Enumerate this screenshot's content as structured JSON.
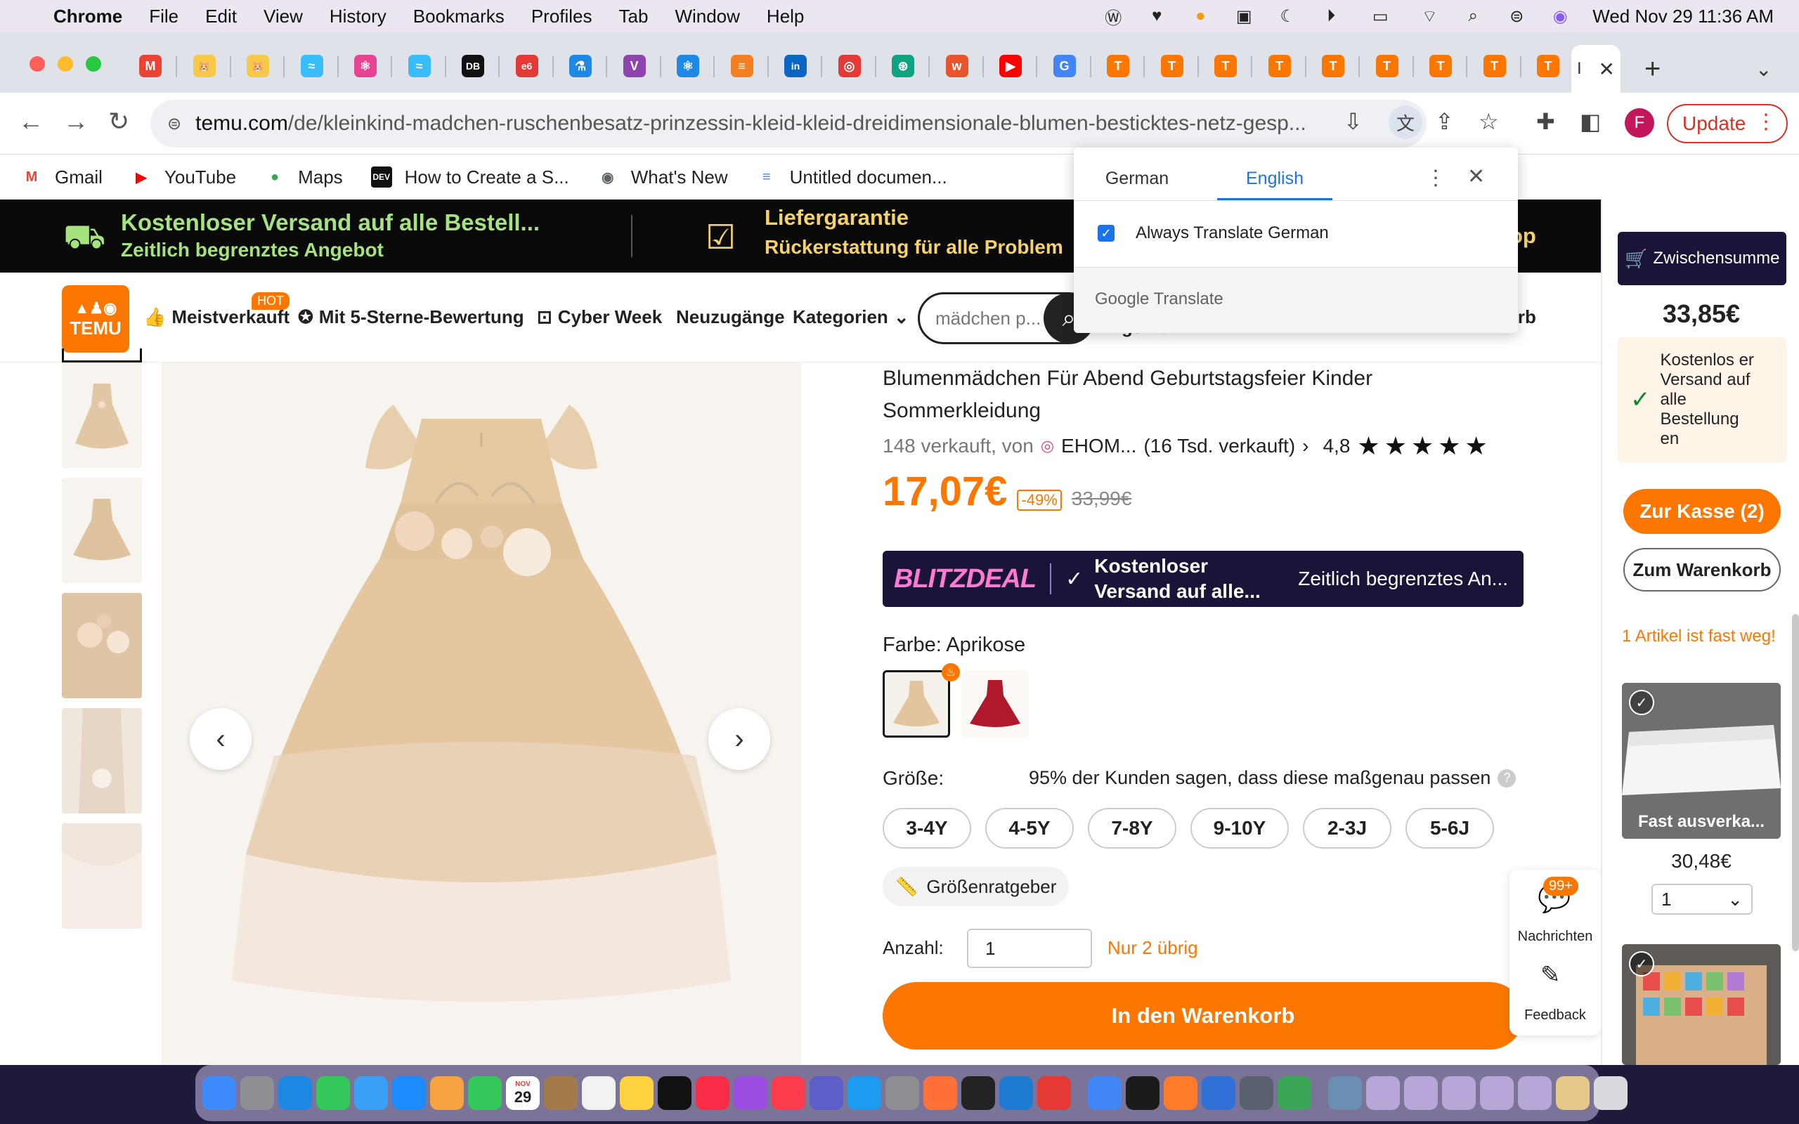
{
  "menubar": {
    "app": "Chrome",
    "items": [
      "File",
      "Edit",
      "View",
      "History",
      "Bookmarks",
      "Profiles",
      "Tab",
      "Window",
      "Help"
    ],
    "datetime": "Wed Nov 29  11:36 AM"
  },
  "tabs": {
    "active_label": "I",
    "favicons": [
      {
        "icon": "gmail-icon",
        "glyph": "M",
        "color": "#ea4335"
      },
      {
        "icon": "hamster-icon",
        "glyph": "🐹",
        "color": "#f7c948"
      },
      {
        "icon": "hamster-icon",
        "glyph": "🐹",
        "color": "#f7c948"
      },
      {
        "icon": "tailwind-icon",
        "glyph": "≈",
        "color": "#38bdf8"
      },
      {
        "icon": "react-icon",
        "glyph": "⚛",
        "color": "#e84393"
      },
      {
        "icon": "tailwind-icon",
        "glyph": "≈",
        "color": "#38bdf8"
      },
      {
        "icon": "db-icon",
        "glyph": "DB",
        "color": "#111111"
      },
      {
        "icon": "e6-icon",
        "glyph": "e6",
        "color": "#e53935"
      },
      {
        "icon": "flask-icon",
        "glyph": "⚗",
        "color": "#1e88e5"
      },
      {
        "icon": "vite-icon",
        "glyph": "V",
        "color": "#8e44ad"
      },
      {
        "icon": "react-icon",
        "glyph": "⚛",
        "color": "#1e88e5"
      },
      {
        "icon": "stackoverflow-icon",
        "glyph": "≡",
        "color": "#f48024"
      },
      {
        "icon": "linkedin-icon",
        "glyph": "in",
        "color": "#0a66c2"
      },
      {
        "icon": "app-icon",
        "glyph": "◎",
        "color": "#e53935"
      },
      {
        "icon": "chatgpt-icon",
        "glyph": "⊛",
        "color": "#10a37f"
      },
      {
        "icon": "w-icon",
        "glyph": "w",
        "color": "#e8552d"
      },
      {
        "icon": "youtube-icon",
        "glyph": "▶",
        "color": "#ff0000"
      },
      {
        "icon": "google-icon",
        "glyph": "G",
        "color": "#4285f4"
      },
      {
        "icon": "temu-icon",
        "glyph": "T",
        "color": "#fb7701"
      },
      {
        "icon": "temu-icon",
        "glyph": "T",
        "color": "#fb7701"
      },
      {
        "icon": "temu-icon",
        "glyph": "T",
        "color": "#fb7701"
      },
      {
        "icon": "temu-icon",
        "glyph": "T",
        "color": "#fb7701"
      },
      {
        "icon": "temu-icon",
        "glyph": "T",
        "color": "#fb7701"
      },
      {
        "icon": "temu-icon",
        "glyph": "T",
        "color": "#fb7701"
      },
      {
        "icon": "temu-icon",
        "glyph": "T",
        "color": "#fb7701"
      },
      {
        "icon": "temu-icon",
        "glyph": "T",
        "color": "#fb7701"
      },
      {
        "icon": "temu-icon",
        "glyph": "T",
        "color": "#fb7701"
      }
    ]
  },
  "address": {
    "host": "temu.com",
    "path": "/de/kleinkind-madchen-ruschenbesatz-prinzessin-kleid-kleid-dreidimensionale-blumen-besticktes-netz-gesp..."
  },
  "toolbar": {
    "update_label": "Update",
    "profile_initial": "F"
  },
  "bookmarks": [
    {
      "label": "Gmail",
      "icon": "gmail-icon",
      "glyph": "M",
      "color": "#ea4335"
    },
    {
      "label": "YouTube",
      "icon": "youtube-icon",
      "glyph": "▶",
      "color": "#ff0000"
    },
    {
      "label": "Maps",
      "icon": "maps-pin-icon",
      "glyph": "●",
      "color": "#34a853"
    },
    {
      "label": "How to Create a S...",
      "icon": "dev-icon",
      "glyph": "DEV",
      "color": "#111111"
    },
    {
      "label": "What's New",
      "icon": "chrome-icon",
      "glyph": "◉",
      "color": "#5f6368"
    },
    {
      "label": "Untitled documen...",
      "icon": "docs-icon",
      "glyph": "≡",
      "color": "#4285f4"
    }
  ],
  "promo": {
    "left_title": "Kostenloser Versand auf alle Bestell...",
    "left_sub": "Zeitlich begrenztes Angebot",
    "mid_title": "Liefergarantie",
    "mid_sub": "Rückerstattung für alle Problem",
    "right_frag": "op"
  },
  "nav": {
    "logo": "TEMU",
    "hot": "HOT",
    "items": [
      "Meistverkauft",
      "Mit 5-Sterne-Bewertung",
      "Cyber Week",
      "Neuzugänge",
      "Kategorien"
    ],
    "search_placeholder": "mädchen p...",
    "hidden_frag1": "gen u...",
    "hidden_frag2": "orb"
  },
  "product": {
    "title": "Blumenmädchen Für Abend Geburtstagsfeier Kinder Sommerkleidung",
    "sold": "148 verkauft, von",
    "seller": "EHOM...",
    "seller_sold": "(16 Tsd. verkauft)",
    "rating": "4,8",
    "stars": "★★★★★",
    "price": "17,07€",
    "discount": "-49%",
    "old_price": "33,99€",
    "blitz_logo": "BLITZDEAL",
    "blitz_text": "Kostenloser Versand auf alle...",
    "blitz_right": "Zeitlich begrenztes An...",
    "color_label": "Farbe: Aprikose",
    "size_label": "Größe:",
    "fit_text": "95% der Kunden sagen, dass diese maßgenau passen",
    "sizes": [
      "3-4Y",
      "4-5Y",
      "7-8Y",
      "9-10Y",
      "2-3J",
      "5-6J"
    ],
    "size_guide": "Größenratgeber",
    "qty_label": "Anzahl:",
    "qty_value": "1",
    "stock_note": "Nur 2 übrig",
    "add_to_cart": "In den Warenkorb"
  },
  "float": {
    "badge": "99+",
    "messages": "Nachrichten",
    "feedback": "Feedback"
  },
  "cart": {
    "subtotal_label": "Zwischensumme",
    "subtotal": "33,85€",
    "shipping": "Kostenlos er Versand auf alle Bestellung en",
    "checkout": "Zur Kasse (2)",
    "view_cart": "Zum Warenkorb",
    "selling_fast": "1 Artikel ist fast weg!",
    "item1_label": "Fast ausverka...",
    "item1_price": "30,48€",
    "item1_qty": "1"
  },
  "translate": {
    "tab_source": "German",
    "tab_target": "English",
    "always": "Always Translate German",
    "brand": "Google Translate"
  },
  "dock": {
    "calendar_month": "NOV",
    "calendar_day": "29",
    "apps": [
      {
        "icon": "finder-icon",
        "color": "#3d8bfd"
      },
      {
        "icon": "launchpad-icon",
        "color": "#8e8e93"
      },
      {
        "icon": "safari-icon",
        "color": "#1e88e5"
      },
      {
        "icon": "messages-icon",
        "color": "#34c759"
      },
      {
        "icon": "mail-icon",
        "color": "#3aa0f5"
      },
      {
        "icon": "appstore-icon",
        "color": "#1a8cff"
      },
      {
        "icon": "photos-icon",
        "color": "#f4a340"
      },
      {
        "icon": "facetime-icon",
        "color": "#34c759"
      },
      {
        "icon": "calendar-icon",
        "color": "#ffffff"
      },
      {
        "icon": "notes-brown-icon",
        "color": "#a37a4a"
      },
      {
        "icon": "reminders-icon",
        "color": "#f2f2f2"
      },
      {
        "icon": "notes-icon",
        "color": "#ffd23f"
      },
      {
        "icon": "appletv-icon",
        "color": "#111111"
      },
      {
        "icon": "music-icon",
        "color": "#fa2d48"
      },
      {
        "icon": "podcasts-icon",
        "color": "#9b4de0"
      },
      {
        "icon": "news-icon",
        "color": "#fa3c4c"
      },
      {
        "icon": "teams-icon",
        "color": "#5b5fc7"
      },
      {
        "icon": "appstore-icon",
        "color": "#1c9bf0"
      },
      {
        "icon": "settings-icon",
        "color": "#8e8e93"
      },
      {
        "icon": "firefox-icon",
        "color": "#ff7139"
      },
      {
        "icon": "terminal-icon",
        "color": "#222222"
      },
      {
        "icon": "vscode-icon",
        "color": "#1f7ad2"
      },
      {
        "icon": "wps-icon",
        "color": "#e53935"
      },
      {
        "icon": "chrome-icon",
        "color": "#4285f4"
      },
      {
        "icon": "activity-icon",
        "color": "#1b1b1b"
      },
      {
        "icon": "pen-icon",
        "color": "#ff7b2c"
      },
      {
        "icon": "mastodon-icon",
        "color": "#2f6fd6"
      },
      {
        "icon": "mastodon-icon",
        "color": "#5a6270"
      },
      {
        "icon": "torrent-icon",
        "color": "#3aa655"
      },
      {
        "icon": "preview-icon",
        "color": "#6a8fb3"
      },
      {
        "icon": "folder-icon",
        "color": "#b7a6d8"
      },
      {
        "icon": "folder-icon",
        "color": "#b7a6d8"
      },
      {
        "icon": "folder-icon",
        "color": "#b7a6d8"
      },
      {
        "icon": "folder-icon",
        "color": "#b7a6d8"
      },
      {
        "icon": "folder-icon",
        "color": "#b7a6d8"
      },
      {
        "icon": "archive-icon",
        "color": "#e6c98a"
      },
      {
        "icon": "trash-icon",
        "color": "#d9d9e0"
      }
    ]
  },
  "colors": {
    "accent": "#fb7701",
    "promo_green": "#a5e37f",
    "promo_yellow": "#f5d36a",
    "blitz_bg": "#1a1438",
    "link_blue": "#1a73e8"
  }
}
